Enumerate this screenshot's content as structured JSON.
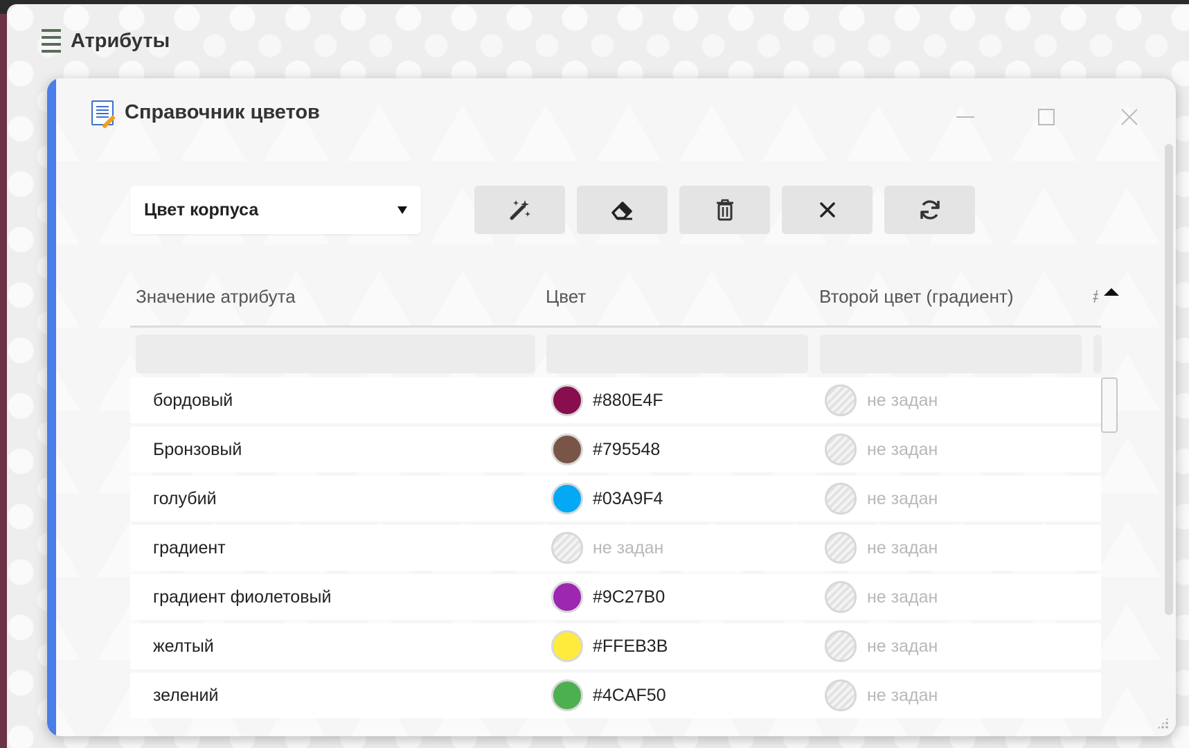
{
  "app": {
    "title": "Атрибуты",
    "menu_icon": "hamburger-icon"
  },
  "dialog": {
    "title": "Справочник цветов",
    "icon": "document-edit-icon",
    "accent_color": "#4A7EE8",
    "controls": {
      "minimize_icon": "minimize-icon",
      "maximize_icon": "maximize-icon",
      "close_icon": "close-icon",
      "close_glyph": "✕"
    }
  },
  "filter": {
    "selected": "Цвет корпуса",
    "arrow_icon": "caret-down-icon"
  },
  "toolbar": {
    "buttons": [
      {
        "name": "magic-wand-icon"
      },
      {
        "name": "eraser-icon"
      },
      {
        "name": "trash-icon"
      },
      {
        "name": "close-icon",
        "glyph": "✕"
      },
      {
        "name": "refresh-icon"
      }
    ]
  },
  "table": {
    "columns": [
      "Значение атрибута",
      "Цвет",
      "Второй цвет (градиент)",
      "#"
    ],
    "rows": [
      {
        "name": "бордовый",
        "color": "#880E4F",
        "color_text": "#880E4F",
        "gradient_text": "не задан"
      },
      {
        "name": "Бронзовый",
        "color": "#795548",
        "color_text": "#795548",
        "gradient_text": "не задан"
      },
      {
        "name": "голубий",
        "color": "#03A9F4",
        "color_text": "#03A9F4",
        "gradient_text": "не задан"
      },
      {
        "name": "градиент",
        "color": null,
        "color_text": "не задан",
        "gradient_text": "не задан"
      },
      {
        "name": "градиент фиолетовый",
        "color": "#9C27B0",
        "color_text": "#9C27B0",
        "gradient_text": "не задан"
      },
      {
        "name": "желтый",
        "color": "#FFEB3B",
        "color_text": "#FFEB3B",
        "gradient_text": "не задан"
      },
      {
        "name": "зелений",
        "color": "#4CAF50",
        "color_text": "#4CAF50",
        "gradient_text": "не задан"
      }
    ]
  }
}
